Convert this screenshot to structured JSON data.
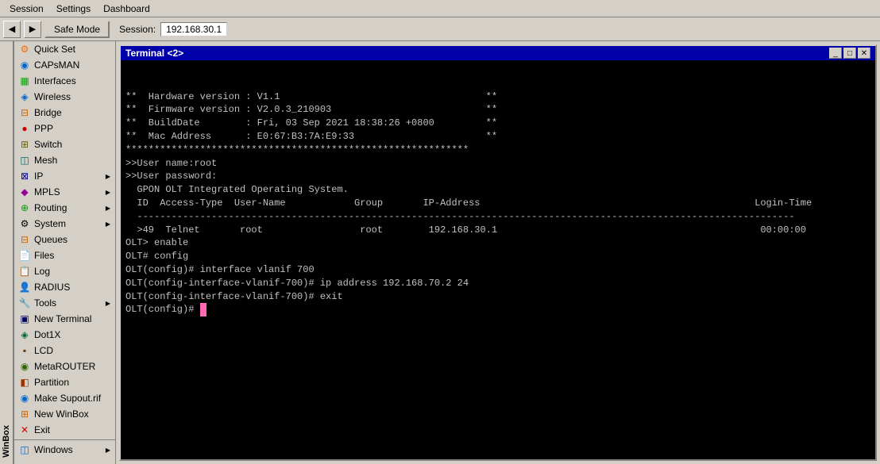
{
  "menubar": {
    "items": [
      "Session",
      "Settings",
      "Dashboard"
    ]
  },
  "toolbar": {
    "back_label": "◀",
    "forward_label": "▶",
    "safe_mode_label": "Safe Mode",
    "session_label": "Session:",
    "session_value": "192.168.30.1"
  },
  "sidebar": {
    "items": [
      {
        "id": "quick-set",
        "label": "Quick Set",
        "icon": "⚙",
        "icon_class": "icon-quick-set",
        "has_sub": false
      },
      {
        "id": "capsman",
        "label": "CAPsMAN",
        "icon": "◉",
        "icon_class": "icon-capsman",
        "has_sub": false
      },
      {
        "id": "interfaces",
        "label": "Interfaces",
        "icon": "▦",
        "icon_class": "icon-interfaces",
        "has_sub": false
      },
      {
        "id": "wireless",
        "label": "Wireless",
        "icon": "◈",
        "icon_class": "icon-wireless",
        "has_sub": false
      },
      {
        "id": "bridge",
        "label": "Bridge",
        "icon": "⊟",
        "icon_class": "icon-bridge",
        "has_sub": false
      },
      {
        "id": "ppp",
        "label": "PPP",
        "icon": "●",
        "icon_class": "icon-ppp",
        "has_sub": false
      },
      {
        "id": "switch",
        "label": "Switch",
        "icon": "⊞",
        "icon_class": "icon-switch",
        "has_sub": false
      },
      {
        "id": "mesh",
        "label": "Mesh",
        "icon": "◫",
        "icon_class": "icon-mesh",
        "has_sub": false
      },
      {
        "id": "ip",
        "label": "IP",
        "icon": "⊠",
        "icon_class": "icon-ip",
        "has_sub": true
      },
      {
        "id": "mpls",
        "label": "MPLS",
        "icon": "◆",
        "icon_class": "icon-mpls",
        "has_sub": true
      },
      {
        "id": "routing",
        "label": "Routing",
        "icon": "⊕",
        "icon_class": "icon-routing",
        "has_sub": true
      },
      {
        "id": "system",
        "label": "System",
        "icon": "⚙",
        "icon_class": "icon-system",
        "has_sub": true
      },
      {
        "id": "queues",
        "label": "Queues",
        "icon": "⊟",
        "icon_class": "icon-queues",
        "has_sub": false
      },
      {
        "id": "files",
        "label": "Files",
        "icon": "📄",
        "icon_class": "icon-files",
        "has_sub": false
      },
      {
        "id": "log",
        "label": "Log",
        "icon": "📋",
        "icon_class": "icon-log",
        "has_sub": false
      },
      {
        "id": "radius",
        "label": "RADIUS",
        "icon": "👤",
        "icon_class": "icon-radius",
        "has_sub": false
      },
      {
        "id": "tools",
        "label": "Tools",
        "icon": "🔧",
        "icon_class": "icon-tools",
        "has_sub": true
      },
      {
        "id": "new-terminal",
        "label": "New Terminal",
        "icon": "▣",
        "icon_class": "icon-new-terminal",
        "has_sub": false
      },
      {
        "id": "dot1x",
        "label": "Dot1X",
        "icon": "◈",
        "icon_class": "icon-dot1x",
        "has_sub": false
      },
      {
        "id": "lcd",
        "label": "LCD",
        "icon": "▪",
        "icon_class": "icon-lcd",
        "has_sub": false
      },
      {
        "id": "metarouter",
        "label": "MetaROUTER",
        "icon": "◉",
        "icon_class": "icon-metarouter",
        "has_sub": false
      },
      {
        "id": "partition",
        "label": "Partition",
        "icon": "◧",
        "icon_class": "icon-partition",
        "has_sub": false
      },
      {
        "id": "make-supout",
        "label": "Make Supout.rif",
        "icon": "◉",
        "icon_class": "icon-make-supout",
        "has_sub": false
      },
      {
        "id": "new-winbox",
        "label": "New WinBox",
        "icon": "⊞",
        "icon_class": "icon-new-winbox",
        "has_sub": false
      },
      {
        "id": "exit",
        "label": "Exit",
        "icon": "✕",
        "icon_class": "icon-exit",
        "has_sub": false
      }
    ],
    "bottom_items": [
      {
        "id": "windows",
        "label": "Windows",
        "icon": "◫",
        "icon_class": "icon-windows",
        "has_sub": true
      }
    ]
  },
  "terminal": {
    "title": "Terminal <2>",
    "content_lines": [
      "**  Hardware version : V1.1                                    **",
      "**  Firmware version : V2.0.3_210903                           **",
      "**  BuildDate        : Fri, 03 Sep 2021 18:38:26 +0800         **",
      "**  Mac Address      : E0:67:B3:7A:E9:33                       **",
      "************************************************************",
      "",
      ">>User name:root",
      ">>User password:",
      "",
      "  GPON OLT Integrated Operating System.",
      "",
      "  ID  Access-Type  User-Name            Group       IP-Address                                                Login-Time",
      "  -------------------------------------------------------------------------------------------------------------------",
      "  >49  Telnet       root                 root        192.168.30.1                                              00:00:00",
      "",
      "OLT> enable",
      "",
      "OLT# config",
      "",
      "OLT(config)# interface vlanif 700",
      "",
      "OLT(config-interface-vlanif-700)# ip address 192.168.70.2 24",
      "",
      "OLT(config-interface-vlanif-700)# exit",
      "",
      "OLT(config)# "
    ]
  },
  "winbox_label": "WinBox"
}
